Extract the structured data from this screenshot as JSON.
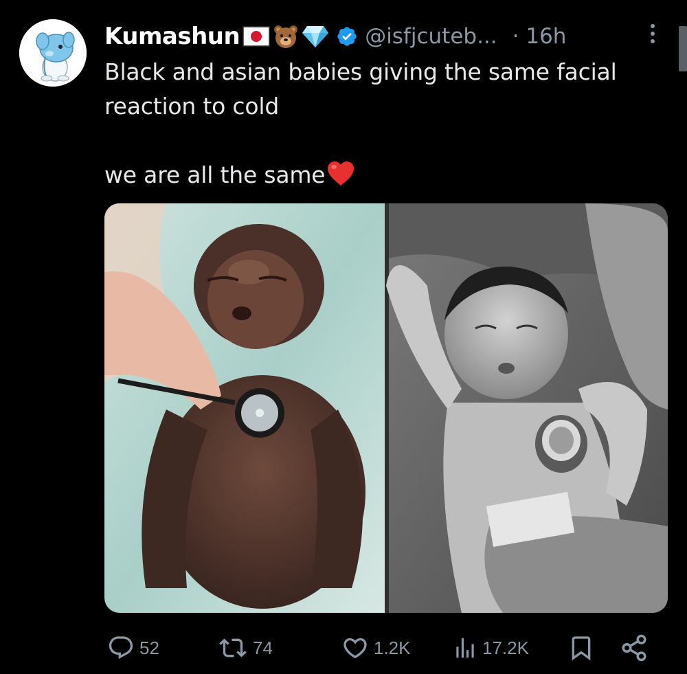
{
  "tweet": {
    "display_name": "Kumashun",
    "name_emojis": [
      "japan-flag",
      "bear-face",
      "gem-stone"
    ],
    "verified": true,
    "handle": "@isfjcuteb...",
    "time": "· 16h",
    "text_lines": [
      "Black and asian babies giving the same facial",
      "reaction to cold"
    ],
    "text_line_2": "we are all the same",
    "text_emoji": "red-heart"
  },
  "actions": {
    "replies": "52",
    "reposts": "74",
    "likes": "1.2K",
    "views": "17.2K"
  },
  "colors": {
    "background": "#000000",
    "text": "#e7e9ea",
    "muted": "#8b98a5",
    "verified": "#1d9bf0"
  }
}
